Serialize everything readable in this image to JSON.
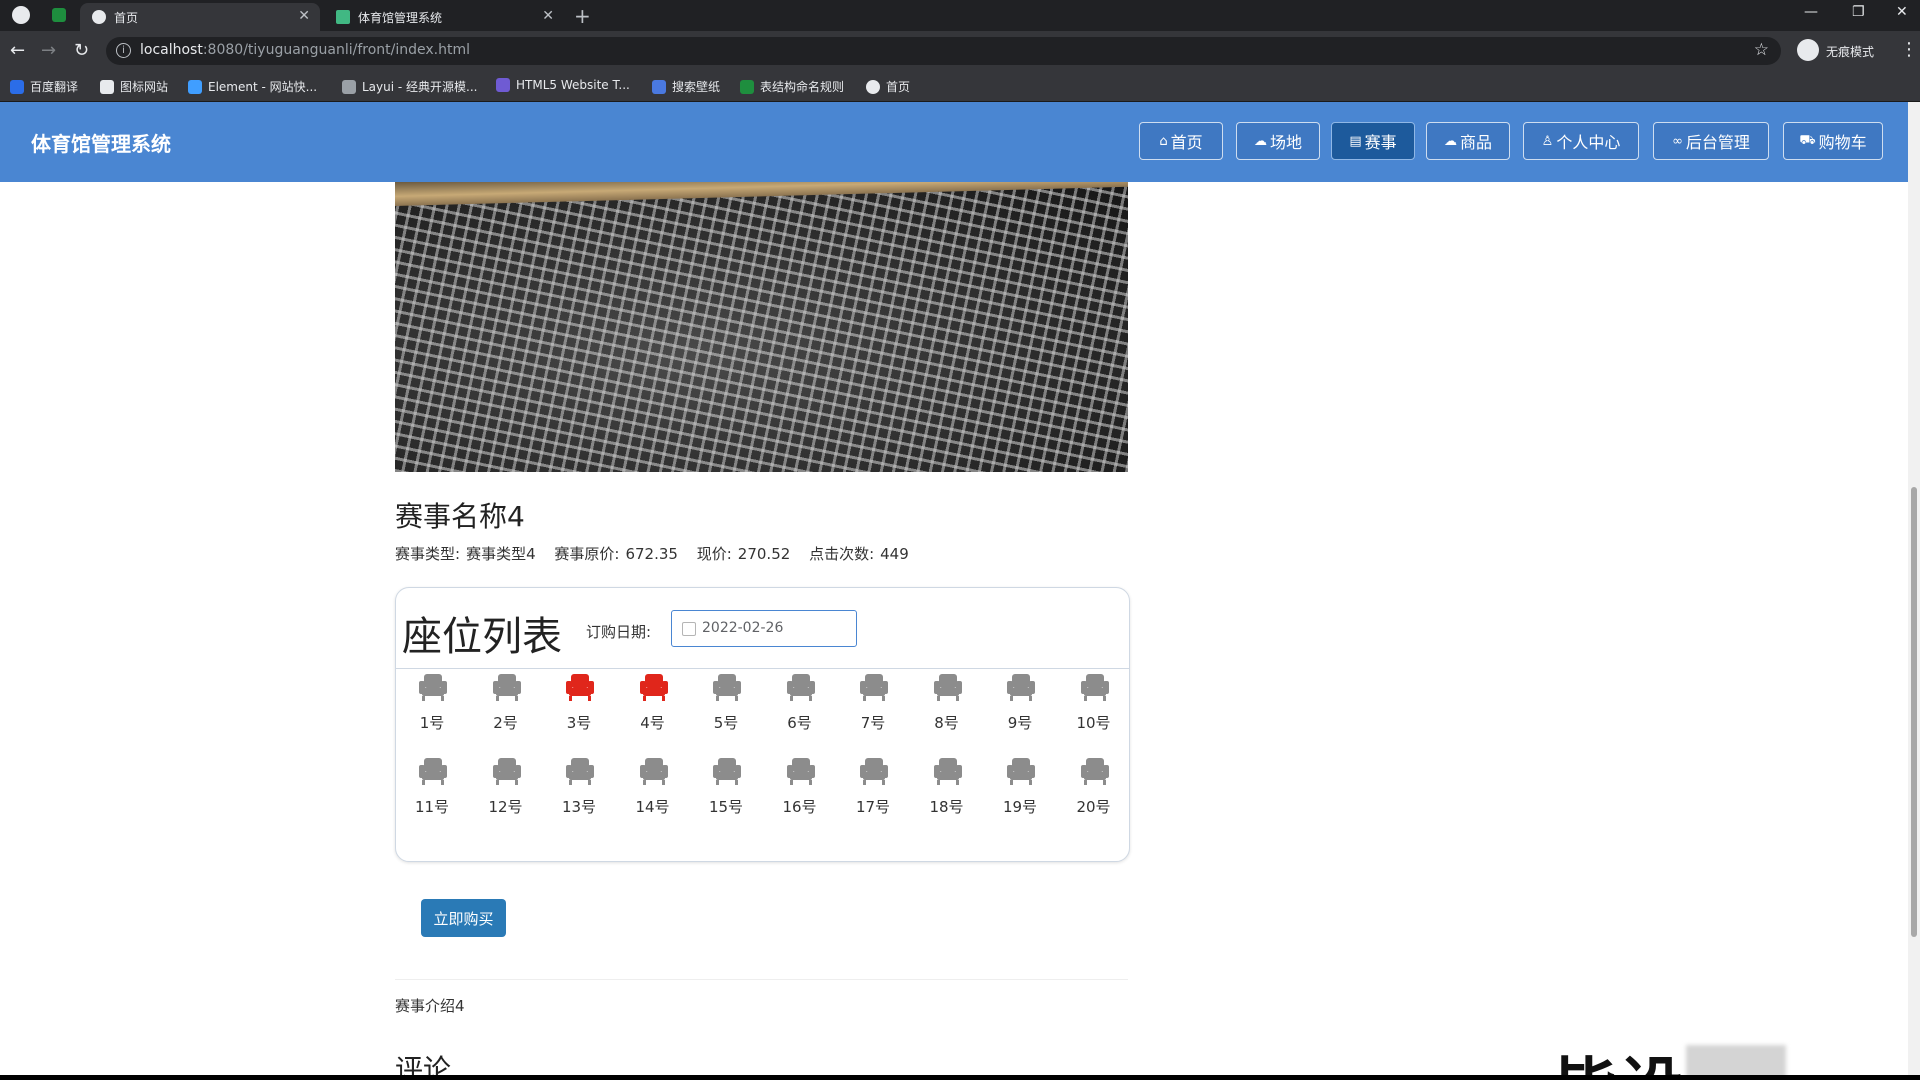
{
  "browser": {
    "tabs": [
      {
        "title": "首页",
        "active": true
      },
      {
        "title": "体育馆管理系统",
        "active": false
      }
    ],
    "url_host": "localhost",
    "url_rest": ":8080/tiyuguanguanli/front/index.html",
    "incognito_label": "无痕模式",
    "bookmarks": [
      "百度翻译",
      "图标网站",
      "Element - 网站快...",
      "Layui - 经典开源模...",
      "HTML5 Website T...",
      "搜索壁纸",
      "表结构命名规则",
      "首页"
    ]
  },
  "header": {
    "brand": "体育馆管理系统",
    "nav": [
      "首页",
      "场地",
      "赛事",
      "商品",
      "个人中心",
      "后台管理",
      "购物车"
    ],
    "active_index": 2
  },
  "event": {
    "title": "赛事名称4",
    "type_label": "赛事类型:",
    "type_value": "赛事类型4",
    "orig_price_label": "赛事原价:",
    "orig_price": "672.35",
    "price_label": "现价:",
    "price": "270.52",
    "clicks_label": "点击次数:",
    "clicks": "449",
    "intro": "赛事介绍4"
  },
  "seats": {
    "title": "座位列表",
    "date_label": "订购日期:",
    "date_value": "2022-02-26",
    "list": [
      {
        "label": "1号",
        "taken": false
      },
      {
        "label": "2号",
        "taken": false
      },
      {
        "label": "3号",
        "taken": true
      },
      {
        "label": "4号",
        "taken": true
      },
      {
        "label": "5号",
        "taken": false
      },
      {
        "label": "6号",
        "taken": false
      },
      {
        "label": "7号",
        "taken": false
      },
      {
        "label": "8号",
        "taken": false
      },
      {
        "label": "9号",
        "taken": false
      },
      {
        "label": "10号",
        "taken": false
      },
      {
        "label": "11号",
        "taken": false
      },
      {
        "label": "12号",
        "taken": false
      },
      {
        "label": "13号",
        "taken": false
      },
      {
        "label": "14号",
        "taken": false
      },
      {
        "label": "15号",
        "taken": false
      },
      {
        "label": "16号",
        "taken": false
      },
      {
        "label": "17号",
        "taken": false
      },
      {
        "label": "18号",
        "taken": false
      },
      {
        "label": "19号",
        "taken": false
      },
      {
        "label": "20号",
        "taken": false
      }
    ],
    "colors": {
      "free": "#8c8c8c",
      "taken": "#e0261b"
    }
  },
  "buy_button": "立即购买",
  "comments_title": "评论",
  "watermark": "毕设"
}
